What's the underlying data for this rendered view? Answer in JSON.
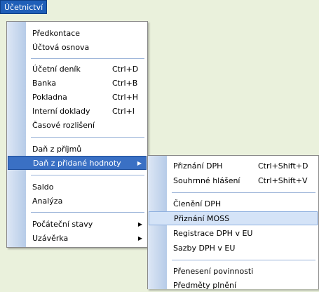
{
  "menubar": {
    "label": "Účetnictví"
  },
  "main_menu": {
    "items": [
      {
        "label": "Předkontace"
      },
      {
        "label": "Účtová osnova"
      },
      {
        "label": "Účetní deník",
        "shortcut": "Ctrl+D"
      },
      {
        "label": "Banka",
        "shortcut": "Ctrl+B"
      },
      {
        "label": "Pokladna",
        "shortcut": "Ctrl+H"
      },
      {
        "label": "Interní doklady",
        "shortcut": "Ctrl+I"
      },
      {
        "label": "Časové rozlišení"
      },
      {
        "label": "Daň z příjmů"
      },
      {
        "label": "Daň z přidané hodnoty",
        "submenu": true,
        "highlighted": true
      },
      {
        "label": "Saldo"
      },
      {
        "label": "Analýza"
      },
      {
        "label": "Počáteční stavy",
        "submenu": true
      },
      {
        "label": "Uzávěrka",
        "submenu": true
      }
    ]
  },
  "submenu": {
    "items": [
      {
        "label": "Přiznání DPH",
        "shortcut": "Ctrl+Shift+D"
      },
      {
        "label": "Souhrnné hlášení",
        "shortcut": "Ctrl+Shift+V"
      },
      {
        "label": "Členění DPH"
      },
      {
        "label": "Přiznání MOSS",
        "hovered": true
      },
      {
        "label": "Registrace DPH v EU"
      },
      {
        "label": "Sazby DPH v EU"
      },
      {
        "label": "Přenesení povinnosti"
      },
      {
        "label": "Předměty plnění"
      }
    ]
  },
  "colors": {
    "background": "#eaf1dc",
    "highlight": "#3a70c4",
    "hover": "#d4e3f7"
  }
}
